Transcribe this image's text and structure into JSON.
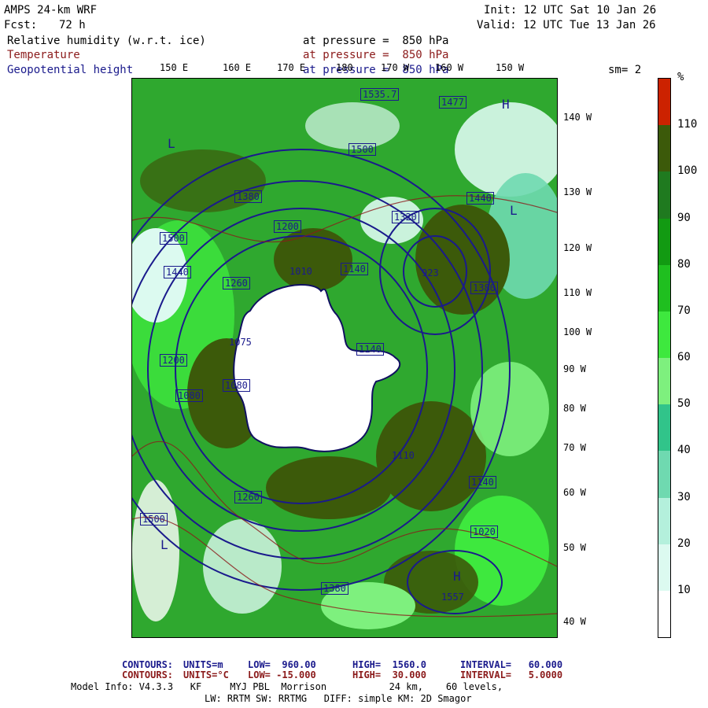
{
  "header": {
    "model": "AMPS 24-km WRF",
    "fcst_label": "Fcst:",
    "fcst_value": "72 h",
    "init": "Init: 12 UTC Sat 10 Jan 26",
    "valid": "Valid: 12 UTC Tue 13 Jan 26",
    "fields": [
      {
        "name": "Relative humidity (w.r.t. ice)",
        "level": "at pressure =  850 hPa",
        "color": "#000000"
      },
      {
        "name": "Temperature",
        "level": "at pressure =  850 hPa",
        "color": "#8b1a1a"
      },
      {
        "name": "Geopotential height",
        "level": "at pressure =  850 hPa",
        "color": "#1a1a8c"
      }
    ],
    "smoothing": "sm= 2"
  },
  "map": {
    "longitude_labels": [
      "150 E",
      "160 E",
      "170 E",
      "180",
      "170 W",
      "160 W",
      "150 W"
    ],
    "latitude_labels": [
      "140 W",
      "130 W",
      "120 W",
      "110 W",
      "100 W",
      "90 W",
      "80 W",
      "70 W",
      "60 W",
      "50 W",
      "40 W"
    ],
    "height_labels": [
      "1535.7",
      "1477",
      "1500",
      "1440",
      "1380",
      "1320",
      "1260",
      "1200",
      "1140",
      "1080",
      "1075",
      "923",
      "1010",
      "1110",
      "1140",
      "1500",
      "1440",
      "1380",
      "1260",
      "1200",
      "1140",
      "1080",
      "1020",
      "1380",
      "1500",
      "1557"
    ],
    "pressure_centers": [
      "L",
      "L",
      "H",
      "H",
      "L"
    ]
  },
  "colorbar": {
    "unit": "%",
    "ticks": [
      "110",
      "100",
      "90",
      "80",
      "70",
      "60",
      "50",
      "40",
      "30",
      "20",
      "10"
    ],
    "colors": [
      "#cc2200",
      "#3c5a0a",
      "#1f7a1f",
      "#129a12",
      "#1fbf1f",
      "#3ee83e",
      "#7ef07e",
      "#31c48a",
      "#6fd9b0",
      "#b4f0dc",
      "#dcfaf0",
      "#ffffff"
    ]
  },
  "footer": {
    "line1": {
      "label": "CONTOURS:",
      "units": "UNITS=m",
      "low": "LOW=  960.00",
      "high": "HIGH=  1560.0",
      "interval": "INTERVAL=   60.000"
    },
    "line2": {
      "label": "CONTOURS:",
      "units": "UNITS=°C",
      "low": "LOW= -15.000",
      "high": "HIGH=  30.000",
      "interval": "INTERVAL=   5.0000"
    },
    "model_info": "Model Info: V4.3.3   KF     MYJ PBL  Morrison           24 km,    60 levels,",
    "model_info2": "LW: RRTM SW: RRTMG   DIFF: simple KM: 2D Smagor"
  }
}
